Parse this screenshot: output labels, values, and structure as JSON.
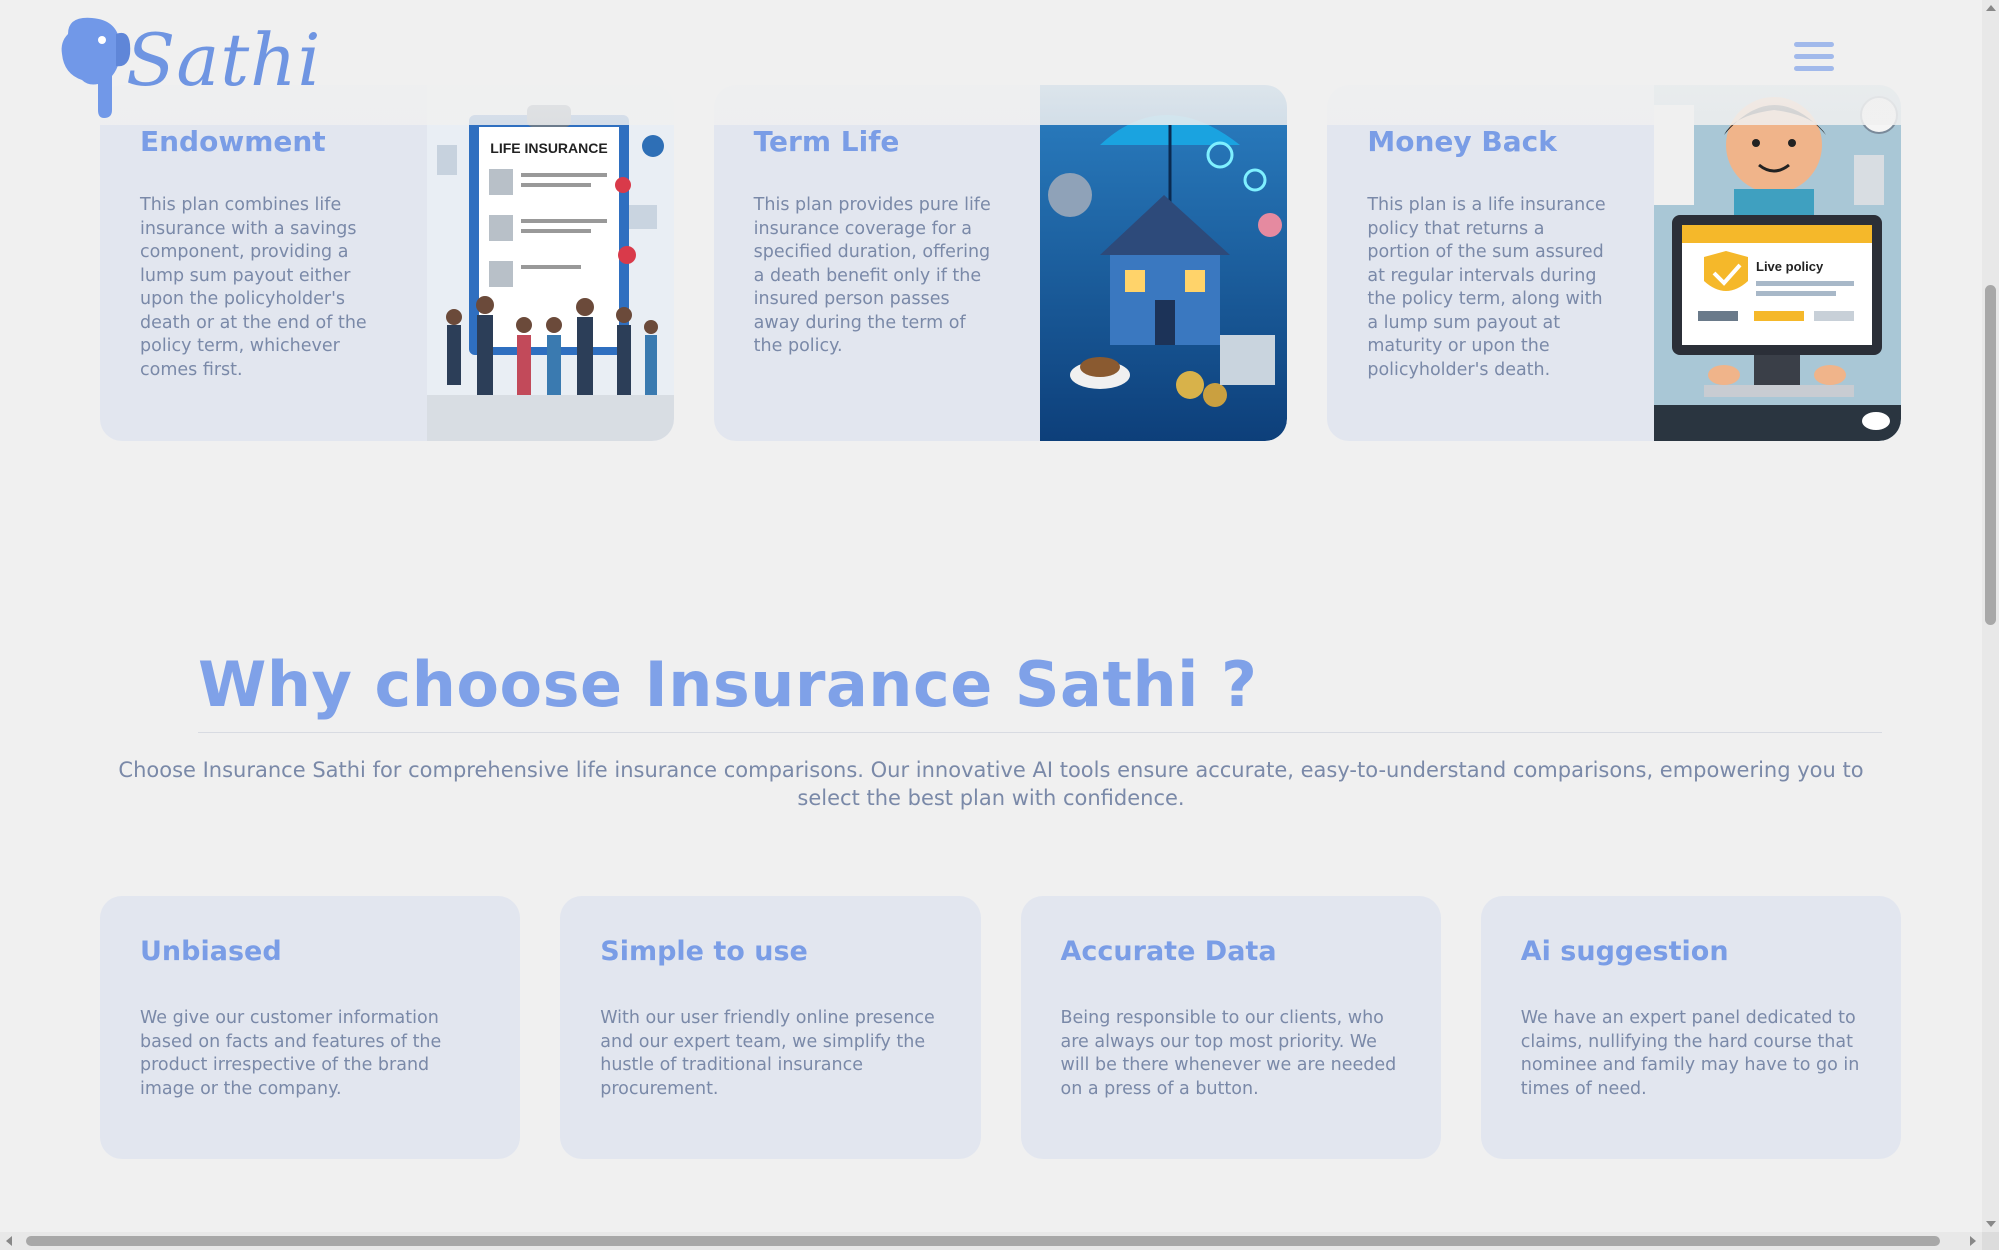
{
  "header": {
    "logo_text": "Sathi",
    "logo_icon": "elephant-icon",
    "menu_icon": "hamburger-menu-icon"
  },
  "plans": [
    {
      "title": "Endowment",
      "description": "This plan combines life insurance with a savings component, providing a lump sum payout either upon the policyholder's death or at the end of the policy term, whichever comes first.",
      "image_label": "LIFE INSURANCE"
    },
    {
      "title": "Term Life",
      "description": "This plan provides pure life insurance coverage for a specified duration, offering a death benefit only if the insured person passes away during the term of the policy.",
      "image_label": ""
    },
    {
      "title": "Money Back",
      "description": "This plan is a life insurance policy that returns a portion of the sum assured at regular intervals during the policy term, along with a lump sum payout at maturity or upon the policyholder's death.",
      "image_label": "Live policy"
    }
  ],
  "why": {
    "title": "Why choose Insurance Sathi ?",
    "description": "Choose Insurance Sathi for comprehensive life insurance comparisons. Our innovative AI tools ensure accurate, easy-to-understand comparisons, empowering you to select the best plan with confidence."
  },
  "features": [
    {
      "title": "Unbiased",
      "description": "We give our customer information based on facts and features of the product irrespective of the brand image or the company."
    },
    {
      "title": "Simple to use",
      "description": "With our user friendly online presence and our expert team, we simplify the hustle of traditional insurance procurement."
    },
    {
      "title": "Accurate Data",
      "description": "Being responsible to our clients, who are always our top most priority. We will be there whenever we are needed on a press of a button."
    },
    {
      "title": "Ai suggestion",
      "description": "We have an expert panel dedicated to claims, nullifying the hard course that nominee and family may have to go in times of need."
    }
  ],
  "colors": {
    "accent": "#7fa1e8",
    "card_bg": "#e2e6ef",
    "page_bg": "#f0f0f0",
    "text": "#7a89a8"
  }
}
